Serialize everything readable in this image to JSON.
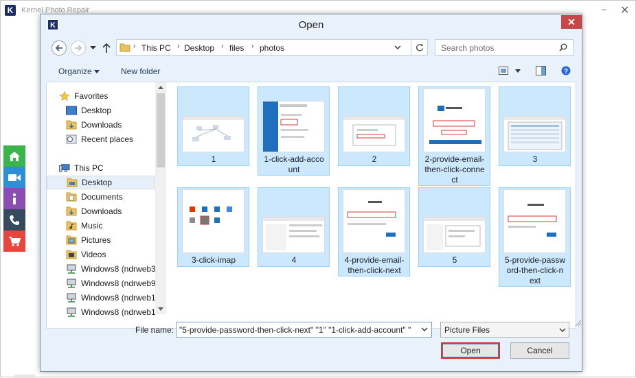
{
  "app": {
    "title": "Kernel Photo Repair",
    "logo_letter": "K",
    "minimize_glyph": "−",
    "close_glyph": "✕",
    "sidebar_buttons": [
      {
        "icon": "home-icon",
        "color": "#39b54a"
      },
      {
        "icon": "video-icon",
        "color": "#2d8fd5"
      },
      {
        "icon": "info-icon",
        "color": "#8a4db3"
      },
      {
        "icon": "phone-icon",
        "color": "#364a5e"
      },
      {
        "icon": "cart-icon",
        "color": "#e8453c"
      }
    ]
  },
  "dialog": {
    "title": "Open",
    "logo_letter": "K",
    "close_glyph": "✕",
    "breadcrumb": [
      "This PC",
      "Desktop",
      "files",
      "photos"
    ],
    "search_placeholder": "Search photos",
    "toolbar": {
      "organize_label": "Organize",
      "new_folder_label": "New folder"
    },
    "nav": {
      "favorites_label": "Favorites",
      "favorites": [
        "Desktop",
        "Downloads",
        "Recent places"
      ],
      "this_pc_label": "This PC",
      "this_pc": [
        "Desktop",
        "Documents",
        "Downloads",
        "Music",
        "Pictures",
        "Videos",
        "Windows8 (ndrweb3",
        "Windows8 (ndrweb9",
        "Windows8 (ndrweb1",
        "Windows8 (ndrweb1"
      ],
      "selected": "Desktop"
    },
    "files": [
      {
        "name": "1",
        "lines": [
          "1"
        ]
      },
      {
        "name": "1-click-add-account",
        "lines": [
          "1-click-add-acco",
          "unt"
        ]
      },
      {
        "name": "2",
        "lines": [
          "2"
        ]
      },
      {
        "name": "2-provide-email-then-click-connect",
        "lines": [
          "2-provide-email-",
          "then-click-conne",
          "ct"
        ]
      },
      {
        "name": "3",
        "lines": [
          "3"
        ]
      },
      {
        "name": "3-click-imap",
        "lines": [
          "3-click-imap"
        ]
      },
      {
        "name": "4",
        "lines": [
          "4"
        ]
      },
      {
        "name": "4-provide-email-then-click-next",
        "lines": [
          "4-provide-email-",
          "then-click-next"
        ]
      },
      {
        "name": "5",
        "lines": [
          "5"
        ]
      },
      {
        "name": "5-provide-password-then-click-next",
        "lines": [
          "5-provide-passw",
          "ord-then-click-n",
          "ext"
        ]
      }
    ],
    "file_name_label": "File name:",
    "file_name_value": "\"5-provide-password-then-click-next\" \"1\" \"1-click-add-account\" \"",
    "file_type_value": "Picture Files",
    "open_label": "Open",
    "cancel_label": "Cancel"
  }
}
